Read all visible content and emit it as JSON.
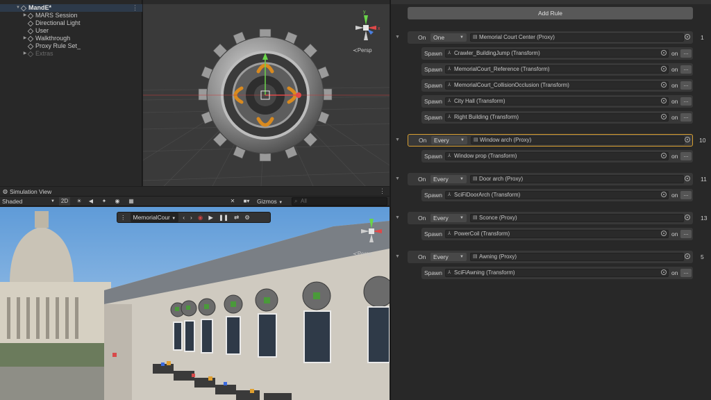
{
  "hierarchy": {
    "root": "MandE*",
    "items": [
      {
        "label": "MARS Session",
        "expandable": true
      },
      {
        "label": "Directional Light",
        "expandable": false
      },
      {
        "label": "User",
        "expandable": false
      },
      {
        "label": "Walkthrough",
        "expandable": true
      },
      {
        "label": "Proxy Rule Set_",
        "expandable": false
      },
      {
        "label": "Extras",
        "expandable": true,
        "dim": true
      }
    ]
  },
  "scene": {
    "shading": "Shaded",
    "gizmos": "Gizmos",
    "persp": "Persp"
  },
  "simulation": {
    "tab_title": "Simulation View",
    "shading": "Shaded",
    "mode_2d": "2D",
    "gizmos": "Gizmos",
    "search_placeholder": "All",
    "environment": "MemorialCour",
    "persp": "Persp"
  },
  "inspector": {
    "add_rule": "Add Rule",
    "on_label": "On",
    "spawn_label": "Spawn",
    "on_toggle": "on",
    "more": "...",
    "rules": [
      {
        "mode": "One",
        "proxy": "Memorial Court Center (Proxy)",
        "count": "1",
        "spawns": [
          "Crawler_BuildingJump (Transform)",
          "MemorialCourt_Reference (Transform)",
          "MemorialCourt_CollisionOcclusion (Transform)",
          "City Hall (Transform)",
          "Right Building (Transform)"
        ]
      },
      {
        "mode": "Every",
        "proxy": "Window arch (Proxy)",
        "count": "10",
        "selected": true,
        "spawns": [
          "Window prop (Transform)"
        ]
      },
      {
        "mode": "Every",
        "proxy": "Door arch (Proxy)",
        "count": "11",
        "spawns": [
          "SciFiDoorArch (Transform)"
        ]
      },
      {
        "mode": "Every",
        "proxy": "Sconce (Proxy)",
        "count": "13",
        "spawns": [
          "PowerCoil (Transform)"
        ]
      },
      {
        "mode": "Every",
        "proxy": "Awning (Proxy)",
        "count": "5",
        "spawns": [
          "SciFiAwning (Transform)"
        ]
      }
    ]
  }
}
